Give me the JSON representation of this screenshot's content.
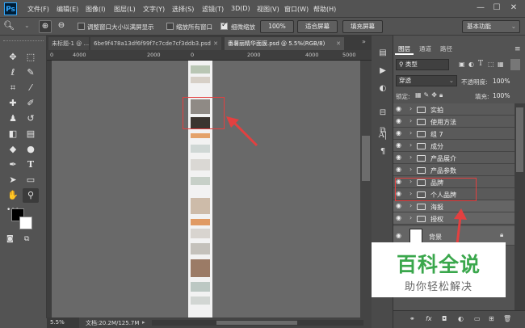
{
  "app": {
    "logo_text": "Ps"
  },
  "menu": [
    "文件(F)",
    "编辑(E)",
    "图像(I)",
    "图层(L)",
    "文字(Y)",
    "选择(S)",
    "滤镜(T)",
    "3D(D)",
    "视图(V)",
    "窗口(W)",
    "帮助(H)"
  ],
  "window_controls": {
    "minimize": "—",
    "maximize": "☐",
    "close": "✕"
  },
  "options": {
    "resize_windows_label": "调整窗口大小以满屏显示",
    "zoom_all_label": "缩放所有窗口",
    "scrubby_zoom_label": "细微缩放",
    "btn_100": "100%",
    "btn_fit": "适合屏幕",
    "btn_fill": "填充屏幕",
    "workspace": "基本功能"
  },
  "tabs": [
    {
      "label": "未标题-1 @ ...",
      "active": false
    },
    {
      "label": "6be9f478a13df6f99f7c7cde7cf3ddb3.psd",
      "active": false
    },
    {
      "label": "番薯丽精华面膜.psd @ 5.5%(RGB/8)",
      "active": true
    }
  ],
  "ruler": {
    "labels": [
      "0",
      "4000",
      "2000",
      "0",
      "2000",
      "4000",
      "5000"
    ]
  },
  "status": {
    "zoom": "5.5%",
    "doc": "文档:20.2M/125.7M"
  },
  "panel": {
    "tabs": [
      "图层",
      "通道",
      "路径"
    ],
    "kind_label": "类型",
    "blend_mode": "穿透",
    "opacity_label": "不透明度:",
    "opacity_value": "100%",
    "lock_label": "锁定:",
    "fill_label": "填充:",
    "fill_value": "100%"
  },
  "layers": [
    {
      "name": "实拍",
      "highlight": false
    },
    {
      "name": "使用方法",
      "highlight": false
    },
    {
      "name": "组 7",
      "highlight": false
    },
    {
      "name": "成分",
      "highlight": false
    },
    {
      "name": "产品展介",
      "highlight": false
    },
    {
      "name": "产品参数",
      "highlight": false
    },
    {
      "name": "品牌",
      "highlight": true
    },
    {
      "name": "个人品牌",
      "highlight": true
    },
    {
      "name": "海报",
      "highlight": false
    },
    {
      "name": "授权",
      "highlight": false
    }
  ],
  "background_layer": {
    "name": "背景"
  },
  "watermark": {
    "title": "百科全说",
    "subtitle": "助你轻松解决"
  },
  "colors": {
    "annotation": "#e34040",
    "ui_bg": "#535353",
    "watermark_title": "#3aa74c"
  },
  "icons": {
    "eye": "eye-icon",
    "folder": "folder-icon",
    "lock": "lock-icon"
  }
}
